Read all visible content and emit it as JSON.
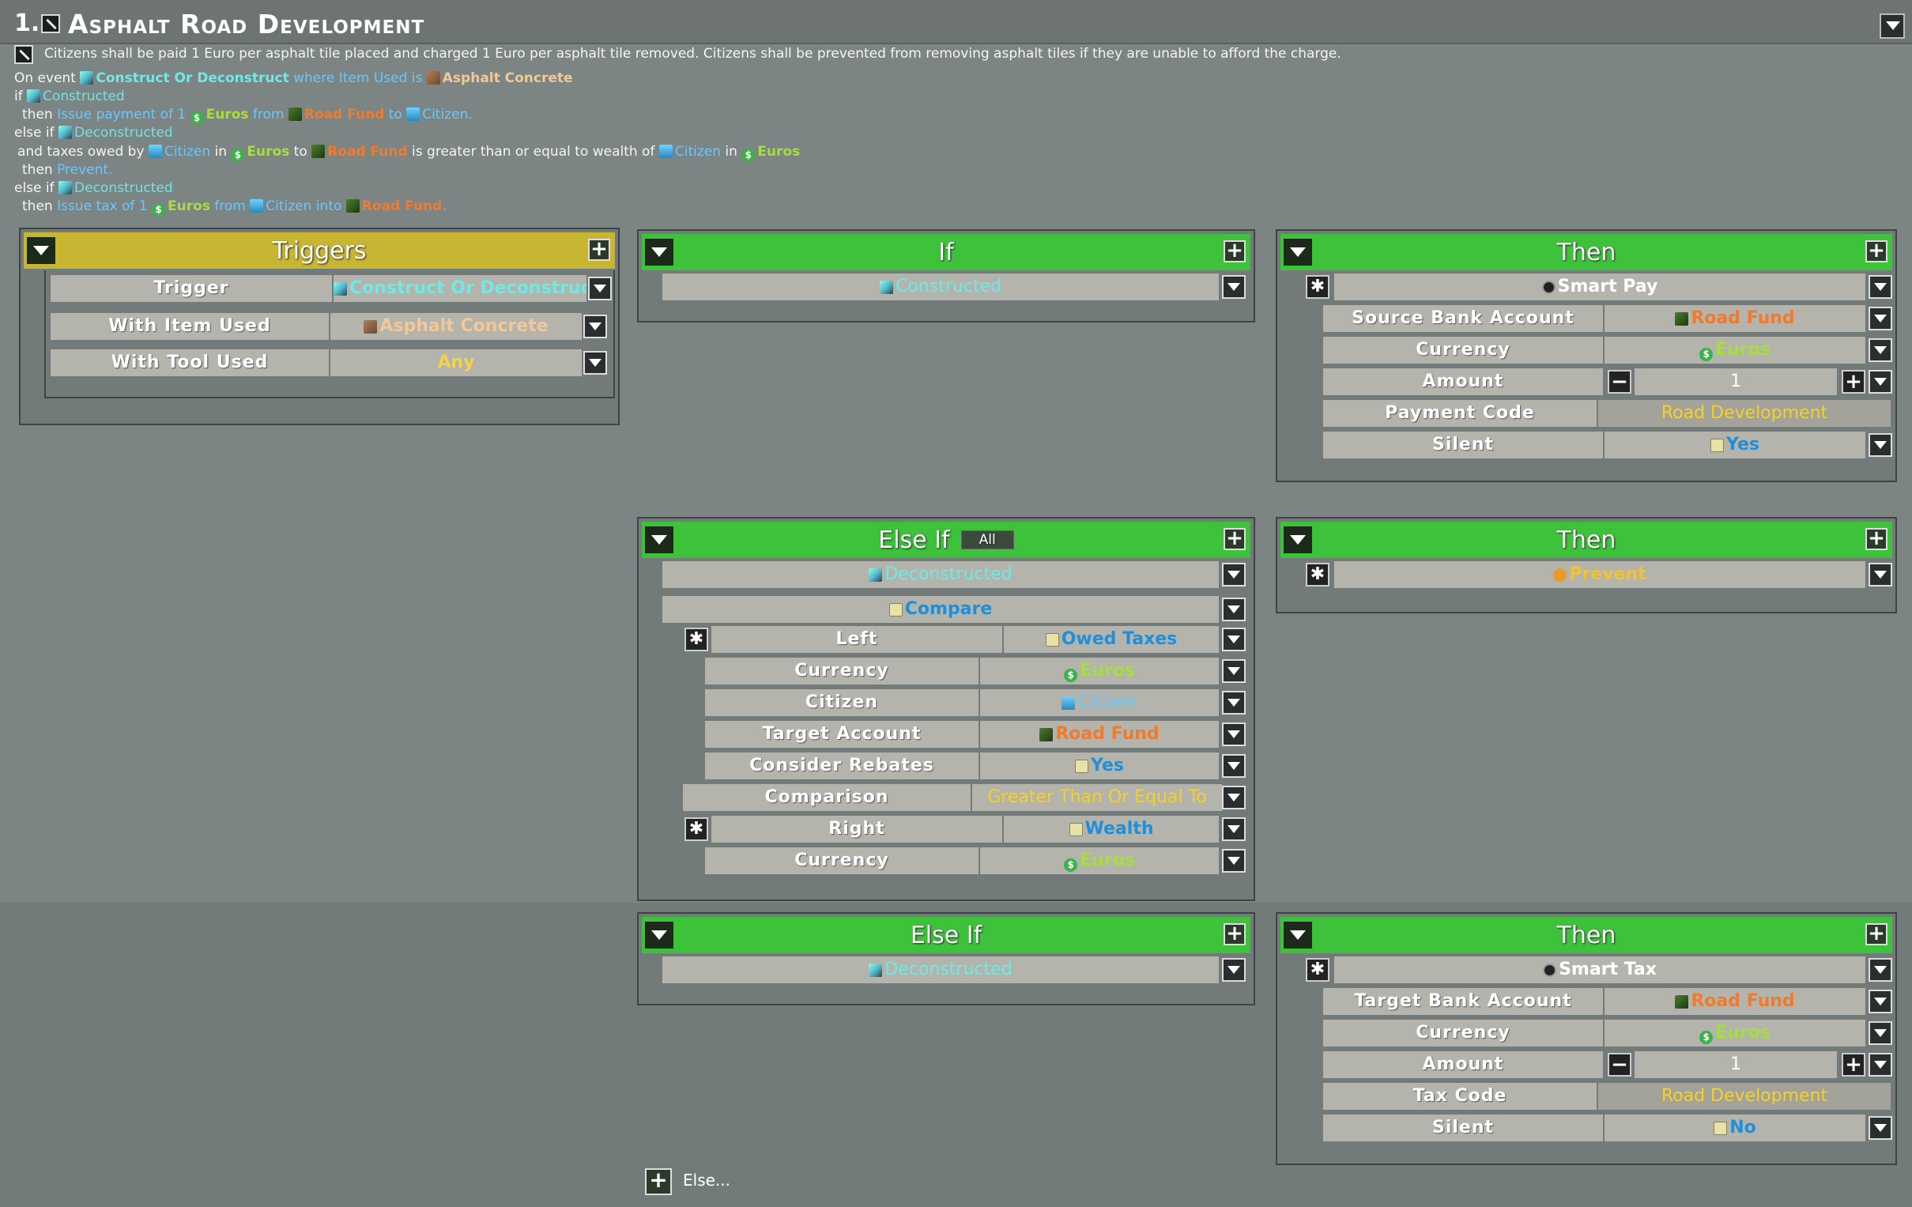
{
  "header": {
    "number": "1.",
    "title": "Asphalt Road Development"
  },
  "description": {
    "summary": "Citizens shall be paid 1 Euro per asphalt tile placed and charged 1 Euro per asphalt tile removed. Citizens shall be prevented from removing asphalt tiles if they are unable to afford the charge.",
    "line1": {
      "a": "On event ",
      "event": "Construct Or Deconstruct",
      "b": " where Item Used is ",
      "item": "Asphalt Concrete"
    },
    "line2": {
      "a": "if ",
      "cond": "Constructed"
    },
    "line3": {
      "a": "then ",
      "action": "Issue payment of 1 ",
      "cur": "Euros",
      "from": " from ",
      "fund": "Road Fund",
      "to": " to ",
      "cit": "Citizen."
    },
    "line4": {
      "a": "else if ",
      "cond": "Deconstructed"
    },
    "line5": {
      "a": "and taxes owed by ",
      "cit": "Citizen",
      "b": " in ",
      "cur": "Euros",
      "c": " to ",
      "fund": "Road Fund",
      "d": " is greater than or equal to wealth of ",
      "cit2": "Citizen",
      "e": " in ",
      "cur2": "Euros"
    },
    "line6": {
      "a": "then ",
      "action": "Prevent."
    },
    "line7": {
      "a": "else if ",
      "cond": "Deconstructed"
    },
    "line8": {
      "a": "then ",
      "action": "Issue tax of 1 ",
      "cur": "Euros",
      "from": " from ",
      "cit": "Citizen",
      "into": " into ",
      "fund": "Road Fund."
    }
  },
  "triggers": {
    "title": "Triggers",
    "rows": [
      {
        "label": "Trigger",
        "value": "Construct Or Deconstruct"
      },
      {
        "label": "With Item Used",
        "value": "Asphalt Concrete"
      },
      {
        "label": "With Tool Used",
        "value": "Any"
      }
    ]
  },
  "if1": {
    "title": "If",
    "condition": "Constructed"
  },
  "then1": {
    "title": "Then",
    "action": "Smart Pay",
    "rows": [
      {
        "label": "Source Bank Account",
        "value": "Road Fund"
      },
      {
        "label": "Currency",
        "value": "Euros"
      },
      {
        "label": "Amount",
        "value": "1"
      },
      {
        "label": "Payment Code",
        "value": "Road Development"
      },
      {
        "label": "Silent",
        "value": "Yes"
      }
    ]
  },
  "elseif1": {
    "title": "Else If",
    "badge": "All",
    "condition": "Deconstructed",
    "compare": "Compare",
    "rows": [
      {
        "label": "Left",
        "value": "Owed Taxes"
      },
      {
        "label": "Currency",
        "value": "Euros"
      },
      {
        "label": "Citizen",
        "value": "Citizen"
      },
      {
        "label": "Target Account",
        "value": "Road Fund"
      },
      {
        "label": "Consider Rebates",
        "value": "Yes"
      },
      {
        "label": "Comparison",
        "value": "Greater Than Or Equal To"
      },
      {
        "label": "Right",
        "value": "Wealth"
      },
      {
        "label": "Currency",
        "value": "Euros"
      }
    ]
  },
  "then2": {
    "title": "Then",
    "action": "Prevent"
  },
  "elseif2": {
    "title": "Else If",
    "condition": "Deconstructed"
  },
  "then3": {
    "title": "Then",
    "action": "Smart Tax",
    "rows": [
      {
        "label": "Target Bank Account",
        "value": "Road Fund"
      },
      {
        "label": "Currency",
        "value": "Euros"
      },
      {
        "label": "Amount",
        "value": "1"
      },
      {
        "label": "Tax Code",
        "value": "Road Development"
      },
      {
        "label": "Silent",
        "value": "No"
      }
    ]
  },
  "footer": {
    "else_label": "Else..."
  }
}
